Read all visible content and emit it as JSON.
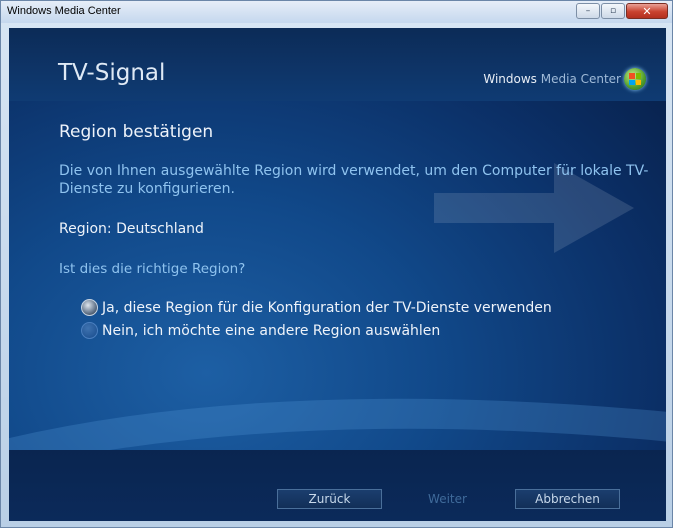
{
  "window": {
    "title": "Windows Media Center",
    "minimize_glyph": "–",
    "maximize_glyph": "▫",
    "close_glyph": "✕"
  },
  "header": {
    "page_title": "TV-Signal",
    "brand_bold": "Windows",
    "brand_light": "Media Center"
  },
  "main": {
    "section_title": "Region bestätigen",
    "description": "Die von Ihnen ausgewählte Region wird verwendet, um den Computer für lokale TV-Dienste zu konfigurieren.",
    "region_label": "Region: Deutschland",
    "question": "Ist dies die richtige Region?",
    "options": [
      {
        "label": "Ja, diese Region für die Konfiguration der TV-Dienste verwenden",
        "selected": true
      },
      {
        "label": "Nein, ich möchte eine andere Region auswählen",
        "selected": false
      }
    ]
  },
  "footer": {
    "back_label": "Zurück",
    "next_label": "Weiter",
    "cancel_label": "Abbrechen"
  },
  "colors": {
    "background": "#0f3b73",
    "accent_text": "#8fc3ef",
    "text": "#eef3fa"
  }
}
